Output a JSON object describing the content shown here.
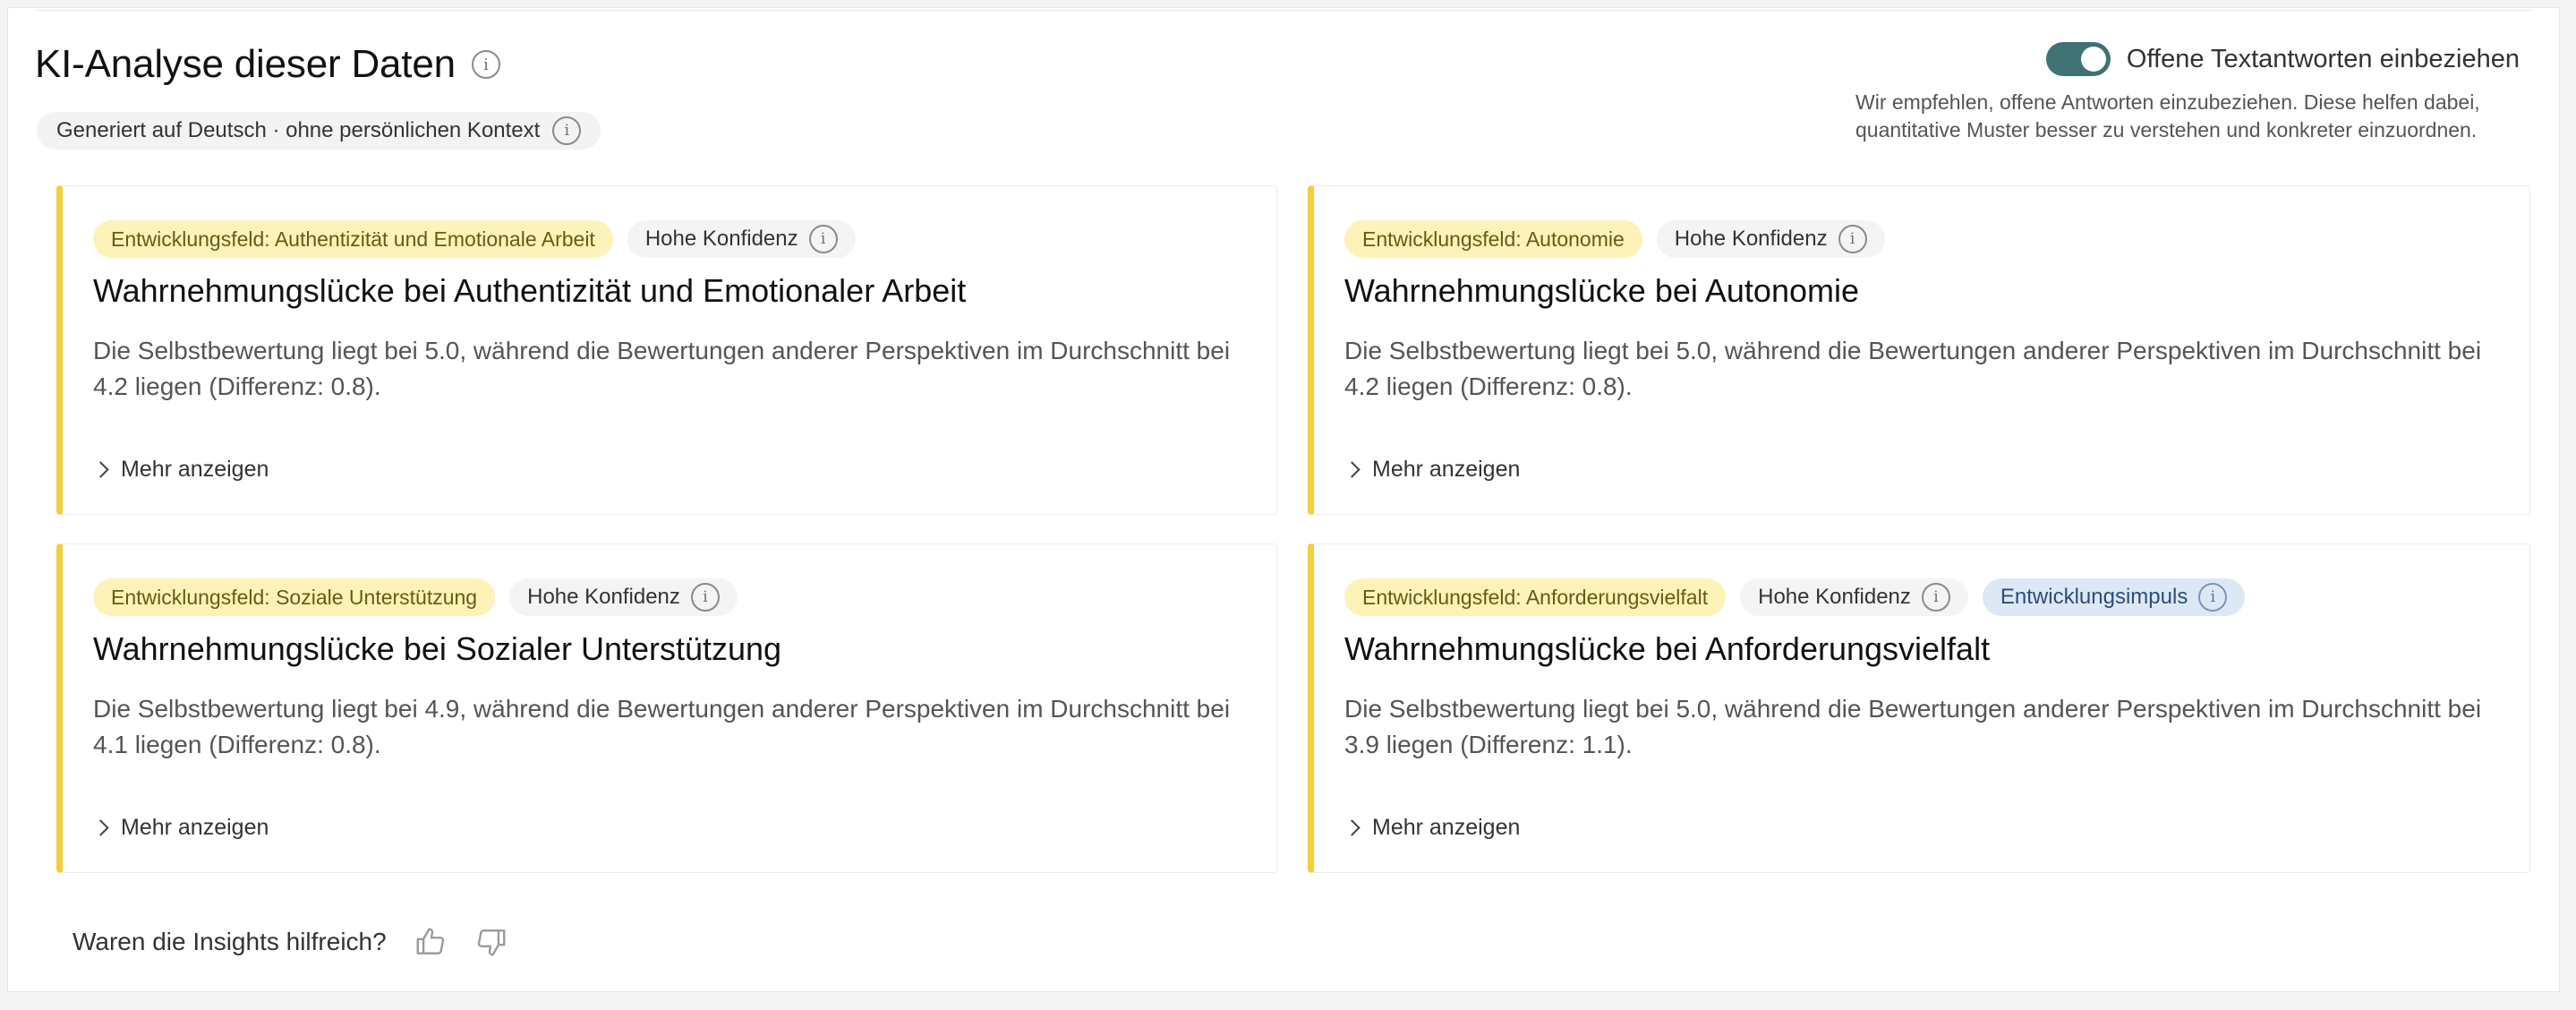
{
  "header": {
    "title": "KI-Analyse dieser Daten",
    "generated_label": "Generiert auf Deutsch · ohne persönlichen Kontext"
  },
  "toggle": {
    "label": "Offene Textantworten einbeziehen",
    "enabled": true,
    "help_text": "Wir empfehlen, offene Antworten einzubeziehen. Diese helfen dabei, quantitative Muster besser zu verstehen und konkreter einzuordnen."
  },
  "cards": [
    {
      "field": "Entwicklungsfeld: Authentizität und Emotionale Arbeit",
      "confidence": "Hohe Konfidenz",
      "title": "Wahrnehmungslücke bei Authentizität und Emotionaler Arbeit",
      "description": "Die Selbstbewertung liegt bei 5.0, während die Bewertungen anderer Perspektiven im Durchschnitt bei 4.2 liegen (Differenz: 0.8).",
      "more": "Mehr anzeigen"
    },
    {
      "field": "Entwicklungsfeld: Autonomie",
      "confidence": "Hohe Konfidenz",
      "title": "Wahrnehmungslücke bei Autonomie",
      "description": "Die Selbstbewertung liegt bei 5.0, während die Bewertungen anderer Perspektiven im Durchschnitt bei 4.2 liegen (Differenz: 0.8).",
      "more": "Mehr anzeigen"
    },
    {
      "field": "Entwicklungsfeld: Soziale Unterstützung",
      "confidence": "Hohe Konfidenz",
      "title": "Wahrnehmungslücke bei Sozialer Unterstützung",
      "description": "Die Selbstbewertung liegt bei 4.9, während die Bewertungen anderer Perspektiven im Durchschnitt bei 4.1 liegen (Differenz: 0.8).",
      "more": "Mehr anzeigen"
    },
    {
      "field": "Entwicklungsfeld: Anforderungsvielfalt",
      "confidence": "Hohe Konfidenz",
      "impulse": "Entwicklungsimpuls",
      "title": "Wahrnehmungslücke bei Anforderungsvielfalt",
      "description": "Die Selbstbewertung liegt bei 5.0, während die Bewertungen anderer Perspektiven im Durchschnitt bei 3.9 liegen (Differenz: 1.1).",
      "more": "Mehr anzeigen"
    }
  ],
  "feedback": {
    "question": "Waren die Insights hilfreich?"
  },
  "colors": {
    "accent_toggle": "#3f7272",
    "card_border_accent": "#f2cf3c",
    "field_badge_bg": "#fdf2b8",
    "impulse_badge_bg": "#dde8f6"
  },
  "icons": [
    "info-icon",
    "chevron-right-icon",
    "thumbs-up-icon",
    "thumbs-down-icon"
  ]
}
